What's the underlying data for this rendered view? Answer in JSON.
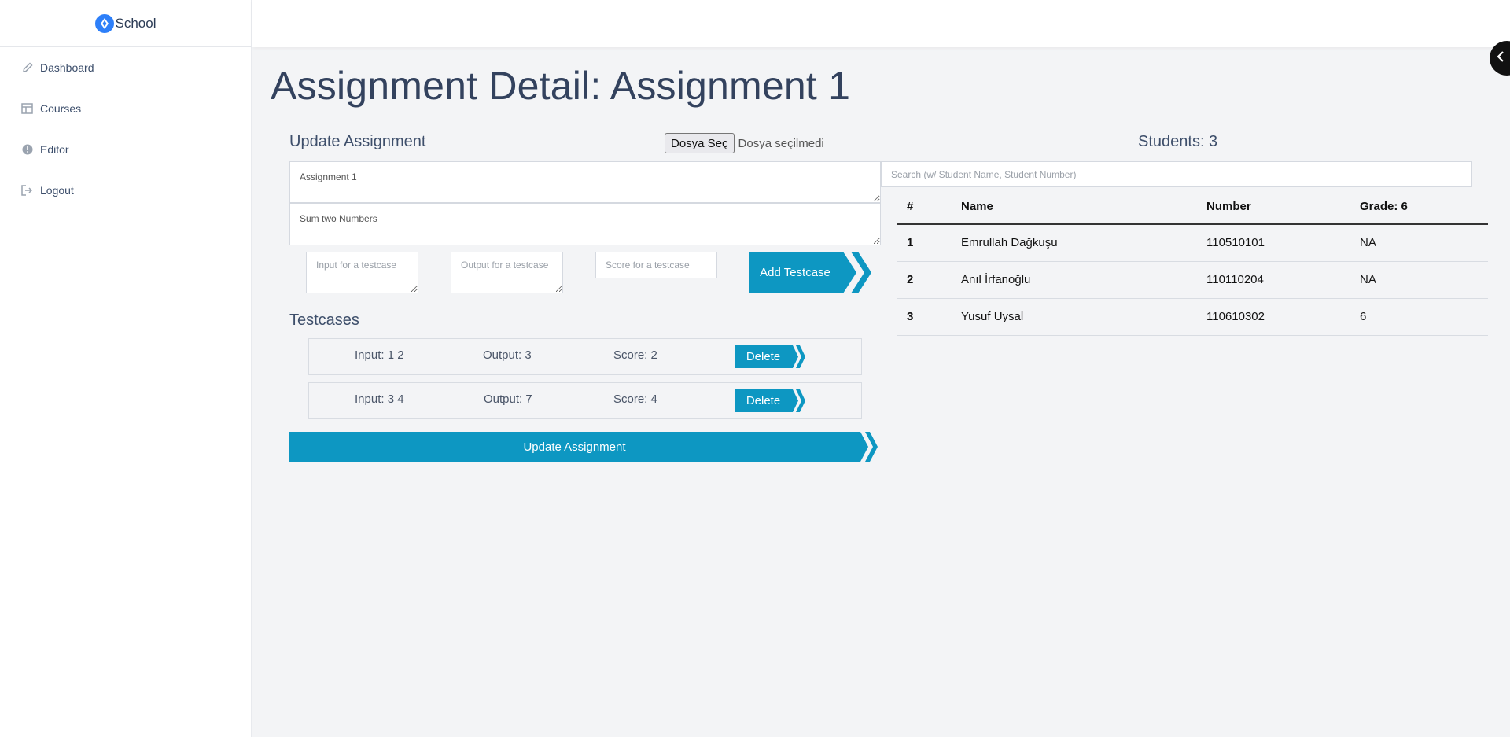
{
  "app": {
    "name": "School"
  },
  "sidebar": {
    "items": [
      {
        "label": "Dashboard",
        "icon": "pencil-icon"
      },
      {
        "label": "Courses",
        "icon": "table-icon"
      },
      {
        "label": "Editor",
        "icon": "info-icon"
      },
      {
        "label": "Logout",
        "icon": "logout-icon"
      }
    ]
  },
  "page": {
    "title": "Assignment Detail: Assignment 1"
  },
  "update": {
    "title": "Update Assignment",
    "file_button": "Dosya Seç",
    "file_status": "Dosya seçilmedi",
    "name_value": "Assignment 1",
    "description_value": "Sum two Numbers",
    "input_placeholder": "Input for a testcase",
    "output_placeholder": "Output for a testcase",
    "score_placeholder": "Score for a testcase",
    "add_testcase_label": "Add Testcase",
    "submit_label": "Update Assignment"
  },
  "testcases": {
    "title": "Testcases",
    "delete_label": "Delete",
    "items": [
      {
        "input": "Input: 1 2",
        "output": "Output: 3",
        "score": "Score: 2"
      },
      {
        "input": "Input: 3 4",
        "output": "Output: 7",
        "score": "Score: 4"
      }
    ]
  },
  "students": {
    "title": "Students: 3",
    "search_placeholder": "Search (w/ Student Name, Student Number)",
    "headers": [
      "#",
      "Name",
      "Number",
      "Grade: 6"
    ],
    "rows": [
      [
        "1",
        "Emrullah Dağkuşu",
        "110510101",
        "NA"
      ],
      [
        "2",
        "Anıl İrfanoğlu",
        "110110204",
        "NA"
      ],
      [
        "3",
        "Yusuf Uysal",
        "110610302",
        "6"
      ]
    ]
  },
  "colors": {
    "accent": "#0d97c2",
    "brand": "#2d7ff9",
    "title": "#33425e"
  }
}
